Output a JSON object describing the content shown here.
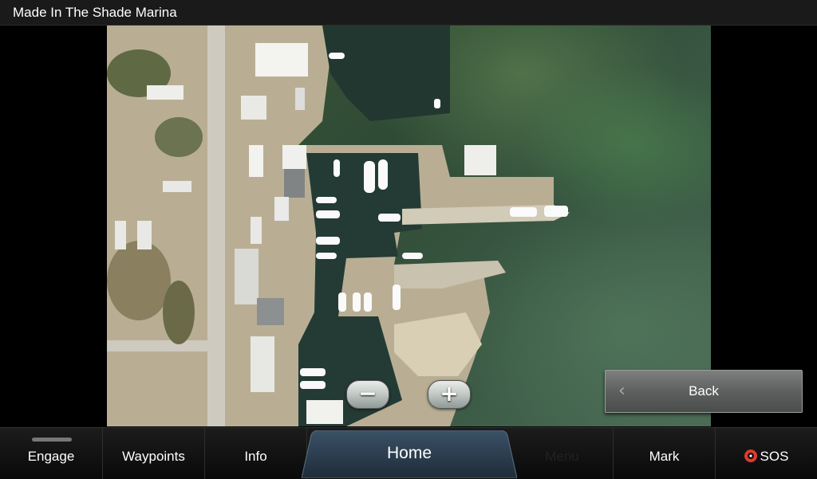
{
  "window": {
    "title": "Made In The Shade Marina"
  },
  "photo": {
    "description_icon": "aerial-marina-photo"
  },
  "zoom": {
    "out_label": "−",
    "in_label": "+"
  },
  "back": {
    "label": "Back"
  },
  "bottom_bar": {
    "engage": "Engage",
    "waypoints": "Waypoints",
    "info": "Info",
    "home": "Home",
    "menu": "Menu",
    "mark": "Mark",
    "sos": "SOS"
  },
  "colors": {
    "sos_red": "#e03a2a",
    "home_tab": "#28394a"
  }
}
